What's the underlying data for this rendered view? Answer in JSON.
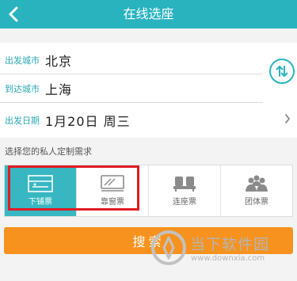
{
  "header": {
    "title": "在线选座"
  },
  "form": {
    "departure": {
      "label": "出发城市",
      "value": "北京"
    },
    "arrival": {
      "label": "到达城市",
      "value": "上海"
    },
    "date": {
      "label": "出发日期",
      "value": "1月20日  周三"
    }
  },
  "seat_prompt": "选择您的私人定制需求",
  "seat_options": [
    {
      "label": "下铺票",
      "icon": "lower-berth-icon",
      "selected": true
    },
    {
      "label": "靠窗票",
      "icon": "window-seat-icon",
      "selected": false
    },
    {
      "label": "连座票",
      "icon": "adjacent-seats-icon",
      "selected": false
    },
    {
      "label": "团体票",
      "icon": "group-icon",
      "selected": false
    }
  ],
  "search_label": "搜索",
  "watermark": {
    "text": "当下软件园",
    "url": "www.downxia.com"
  },
  "colors": {
    "accent": "#29b3bf",
    "search": "#f7921e",
    "highlight_box": "#e01c24"
  }
}
